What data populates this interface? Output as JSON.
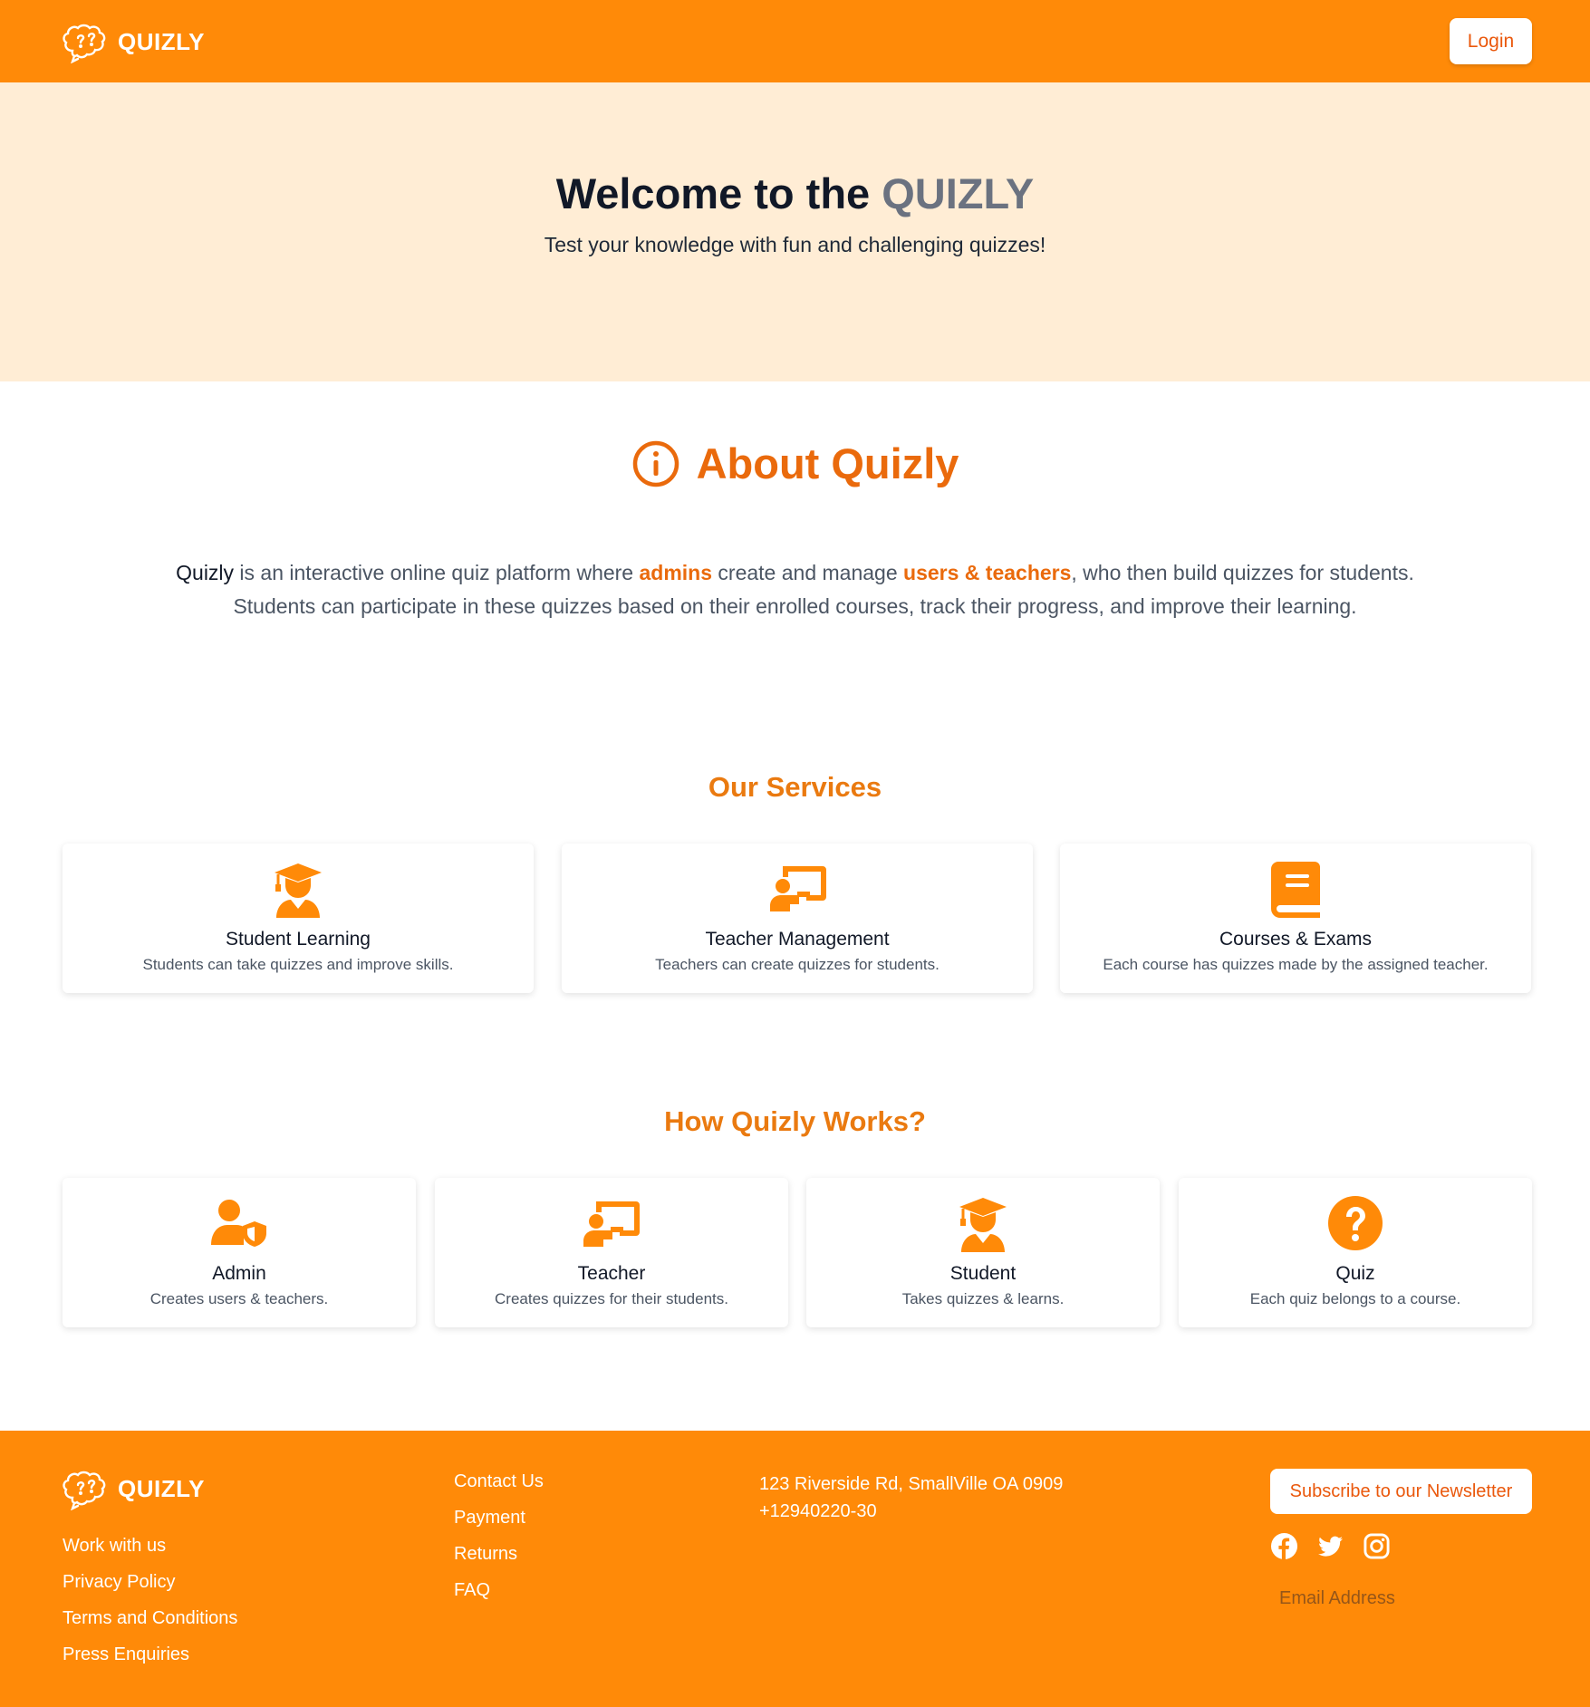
{
  "header": {
    "brand": "QUIZLY",
    "login_label": "Login"
  },
  "hero": {
    "title_prefix": "Welcome to the ",
    "title_accent": "QUIZLY",
    "subtitle": "Test your knowledge with fun and challenging quizzes!"
  },
  "about": {
    "title": "About Quizly",
    "p1": "Quizly",
    "p2": " is an interactive online quiz platform where ",
    "p3": "admins",
    "p4": " create and manage ",
    "p5": "users & teachers",
    "p6": ", who then build quizzes for students. Students can participate in these quizzes based on their enrolled courses, track their progress, and improve their learning."
  },
  "services": {
    "heading": "Our Services",
    "items": [
      {
        "title": "Student Learning",
        "desc": "Students can take quizzes and improve skills.",
        "icon": "graduate-icon"
      },
      {
        "title": "Teacher Management",
        "desc": "Teachers can create quizzes for students.",
        "icon": "teacher-board-icon"
      },
      {
        "title": "Courses & Exams",
        "desc": "Each course has quizzes made by the assigned teacher.",
        "icon": "book-icon"
      }
    ]
  },
  "how": {
    "heading": "How Quizly Works?",
    "items": [
      {
        "title": "Admin",
        "desc": "Creates users & teachers.",
        "icon": "user-shield-icon"
      },
      {
        "title": "Teacher",
        "desc": "Creates quizzes for their students.",
        "icon": "teacher-board-icon"
      },
      {
        "title": "Student",
        "desc": "Takes quizzes & learns.",
        "icon": "graduate-icon"
      },
      {
        "title": "Quiz",
        "desc": "Each quiz belongs to a course.",
        "icon": "question-circle-icon"
      }
    ]
  },
  "footer": {
    "brand": "QUIZLY",
    "col1": [
      "Work with us",
      "Privacy Policy",
      "Terms and Conditions",
      "Press Enquiries"
    ],
    "col2": [
      "Contact Us",
      "Payment",
      "Returns",
      "FAQ"
    ],
    "address": "123 Riverside Rd, SmallVille OA 0909",
    "phone": "+12940220-30",
    "subscribe_label": "Subscribe to our Newsletter",
    "email_placeholder": "Email Address",
    "socials": [
      "facebook-icon",
      "twitter-icon",
      "instagram-icon"
    ]
  },
  "colors": {
    "brand_orange": "#ff8a08",
    "accent_orange": "#ea6a0c",
    "hero_bg": "#ffedd5"
  }
}
